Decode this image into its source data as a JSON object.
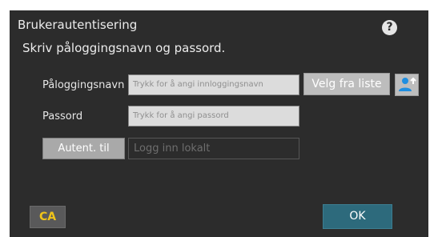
{
  "dialog": {
    "title": "Brukerautentisering",
    "instruction": "Skriv påloggingsnavn og passord."
  },
  "help": {
    "icon": "help-icon",
    "glyph": "?"
  },
  "login": {
    "label": "Påloggingsnavn",
    "placeholder": "Trykk for å angi innloggingsnavn",
    "pick_from_list_label": "Velg fra liste",
    "user_icon": "user-select-icon"
  },
  "password": {
    "label": "Passord",
    "placeholder": "Trykk for å angi passord"
  },
  "auth": {
    "button_label": "Autent. til",
    "value": "Logg inn lokalt"
  },
  "footer": {
    "ca_label": "CA",
    "ok_label": "OK"
  },
  "colors": {
    "dialog_bg": "#2c2c2c",
    "ca_text": "#f0c419",
    "ok_bg": "#2d6a7c",
    "user_icon": "#1f8ee0"
  }
}
